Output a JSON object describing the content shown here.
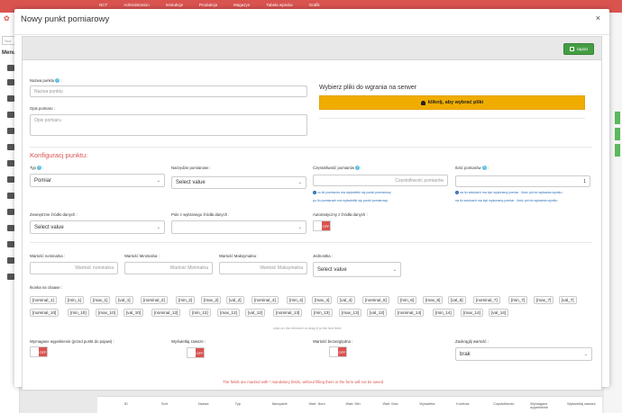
{
  "bg": {
    "nav": [
      "NCT",
      "Administration",
      "Instrukcje",
      "Produkcja",
      "Magazyn",
      "Tabela wpisów",
      "Grafik"
    ],
    "sidebar_search_placeholder": "Sea",
    "sidebar_menu_label": "Menu",
    "table_headers": [
      "ID",
      "Sort",
      "Nazwa",
      "Typ",
      "Narzędzie",
      "Wart. Nom",
      "Wart. Min",
      "Wart. Max",
      "Wyświetla",
      "Kontrola",
      "Częstotliwość",
      "Wymagane wypełnienie",
      "Wyświetlaj zawsze"
    ]
  },
  "modal": {
    "title": "Nowy punkt pomiarowy",
    "close": "×",
    "save_label": "zapisz",
    "fields": {
      "name_label": "Nazwa punktu",
      "name_placeholder": "Nazwa punktu",
      "desc_label": "Opis pomiaru",
      "desc_placeholder": "Opis pomiaru"
    },
    "upload": {
      "title": "Wybierz pliki do wgrania na serwer",
      "button": "kliknij, aby wybrać pliki"
    },
    "config": {
      "title": "Konfiguracj punktu:",
      "type_label": "Typ",
      "type_value": "Pomiar",
      "tool_label": "Narzędzie pomiarowe",
      "tool_value": "Select value",
      "freq_label": "Częstotliwość pomiarów",
      "freq_placeholder": "Częstotliwość pomiarów",
      "freq_hint1": "co ile pomiarów ma wyświetlić się punkt pomiarowy",
      "freq_hint2": "po ilu pomiarach ma wyświetlić się punkt pomiarowy",
      "count_label": "Ilość pomiarów",
      "count_value": "1",
      "count_hint1": "na ilu sztukach ma być wykonany pomiar - ilość pól do wpisania wyniku",
      "count_hint2": "na ilu sztukach ma być wykonany pomiar - ilość pól do wpisania wyniku",
      "ext_label": "Zewnętrzne źródło danych",
      "ext_value": "Select value",
      "field_label": "Pole z wybranego źródła danych",
      "field_value": "",
      "auto_label": "Automatyczny z źródła danych",
      "auto_state": "OFF",
      "nom_label": "Wartość nominalna",
      "nom_placeholder": "Wartość nominalna",
      "min_label": "Wartość Minimalna",
      "min_placeholder": "Wartość Minimalna",
      "max_label": "Wartość Maksymalna",
      "max_placeholder": "Wartość Maksymalna",
      "unit_label": "Jednostka",
      "unit_value": "Select value",
      "placeholders_label": "Ikonka na chaase",
      "placeholders": [
        "[nominal_1]",
        "[min_1]",
        "[max_1]",
        "[val_1]",
        "[nominal_2]",
        "[min_2]",
        "[max_2]",
        "[val_2]",
        "[nominal_4]",
        "[min_4]",
        "[max_4]",
        "[val_4]",
        "[nominal_6]",
        "[min_6]",
        "[max_6]",
        "[val_6]",
        "[nominal_7]",
        "[min_7]",
        "[max_7]",
        "[val_7]",
        "[nominal_10]",
        "[min_10]",
        "[max_10]",
        "[val_10]",
        "[nominal_12]",
        "[min_12]",
        "[max_12]",
        "[val_12]",
        "[nominal_13]",
        "[min_13]",
        "[max_13]",
        "[val_13]",
        "[nominal_14]",
        "[min_14]",
        "[max_14]",
        "[val_14]"
      ],
      "drag_note": "click on the element or drag it to the text field",
      "required_label": "Wymagane wypełnienie (przed punkt do pojawi)",
      "required_state": "OFF",
      "always_label": "Wyświetlaj zawsze",
      "always_state": "OFF",
      "absolute_label": "Wartość bezwzględna",
      "absolute_state": "OFF",
      "round_label": "Zaokrąglij wartość",
      "round_value": "brak"
    },
    "footer_note": "The fields are marked with * mandatory fields, without filling them in the form will not be saved"
  }
}
